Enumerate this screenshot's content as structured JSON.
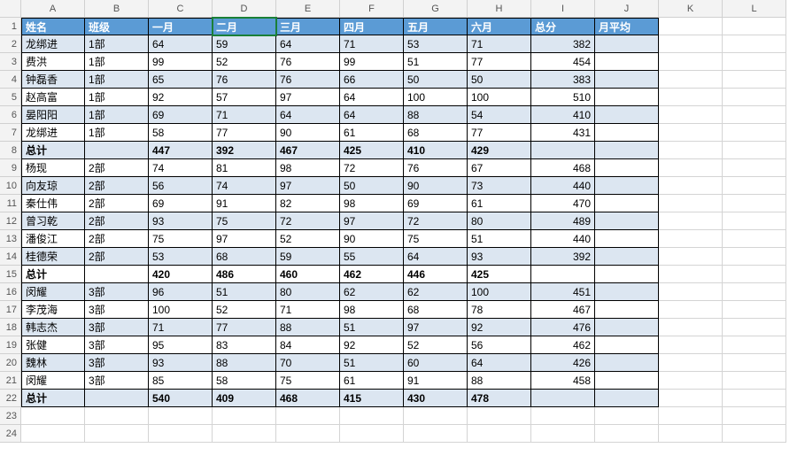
{
  "columns": [
    "A",
    "B",
    "C",
    "D",
    "E",
    "F",
    "G",
    "H",
    "I",
    "J",
    "K",
    "L"
  ],
  "row_count": 24,
  "data_region": {
    "cols": 10,
    "rows": 22
  },
  "active_cell": {
    "row": 1,
    "col": "D"
  },
  "headers": [
    "姓名",
    "班级",
    "一月",
    "二月",
    "三月",
    "四月",
    "五月",
    "六月",
    "总分",
    "月平均"
  ],
  "rows": [
    {
      "name": "龙绑进",
      "cls": "1部",
      "m": [
        64,
        59,
        64,
        71,
        53,
        71
      ],
      "total": 382
    },
    {
      "name": "费洪",
      "cls": "1部",
      "m": [
        99,
        52,
        76,
        99,
        51,
        77
      ],
      "total": 454
    },
    {
      "name": "钟磊香",
      "cls": "1部",
      "m": [
        65,
        76,
        76,
        66,
        50,
        50
      ],
      "total": 383
    },
    {
      "name": "赵高富",
      "cls": "1部",
      "m": [
        92,
        57,
        97,
        64,
        100,
        100
      ],
      "total": 510
    },
    {
      "name": "晏阳阳",
      "cls": "1部",
      "m": [
        69,
        71,
        64,
        64,
        88,
        54
      ],
      "total": 410
    },
    {
      "name": "龙绑进",
      "cls": "1部",
      "m": [
        58,
        77,
        90,
        61,
        68,
        77
      ],
      "total": 431
    },
    {
      "subtotal": true,
      "name": "总计",
      "m": [
        447,
        392,
        467,
        425,
        410,
        429
      ]
    },
    {
      "name": "杨现",
      "cls": "2部",
      "m": [
        74,
        81,
        98,
        72,
        76,
        67
      ],
      "total": 468
    },
    {
      "name": "向友琼",
      "cls": "2部",
      "m": [
        56,
        74,
        97,
        50,
        90,
        73
      ],
      "total": 440
    },
    {
      "name": "秦仕伟",
      "cls": "2部",
      "m": [
        69,
        91,
        82,
        98,
        69,
        61
      ],
      "total": 470
    },
    {
      "name": "曾习乾",
      "cls": "2部",
      "m": [
        93,
        75,
        72,
        97,
        72,
        80
      ],
      "total": 489
    },
    {
      "name": "潘俊江",
      "cls": "2部",
      "m": [
        75,
        97,
        52,
        90,
        75,
        51
      ],
      "total": 440
    },
    {
      "name": "桂德荣",
      "cls": "2部",
      "m": [
        53,
        68,
        59,
        55,
        64,
        93
      ],
      "total": 392
    },
    {
      "subtotal": true,
      "name": "总计",
      "m": [
        420,
        486,
        460,
        462,
        446,
        425
      ]
    },
    {
      "name": "闵耀",
      "cls": "3部",
      "m": [
        96,
        51,
        80,
        62,
        62,
        100
      ],
      "total": 451
    },
    {
      "name": "李茂海",
      "cls": "3部",
      "m": [
        100,
        52,
        71,
        98,
        68,
        78
      ],
      "total": 467
    },
    {
      "name": "韩志杰",
      "cls": "3部",
      "m": [
        71,
        77,
        88,
        51,
        97,
        92
      ],
      "total": 476
    },
    {
      "name": "张健",
      "cls": "3部",
      "m": [
        95,
        83,
        84,
        92,
        52,
        56
      ],
      "total": 462
    },
    {
      "name": "魏林",
      "cls": "3部",
      "m": [
        93,
        88,
        70,
        51,
        60,
        64
      ],
      "total": 426
    },
    {
      "name": "闵耀",
      "cls": "3部",
      "m": [
        85,
        58,
        75,
        61,
        91,
        88
      ],
      "total": 458
    },
    {
      "subtotal": true,
      "name": "总计",
      "m": [
        540,
        409,
        468,
        415,
        430,
        478
      ]
    }
  ]
}
